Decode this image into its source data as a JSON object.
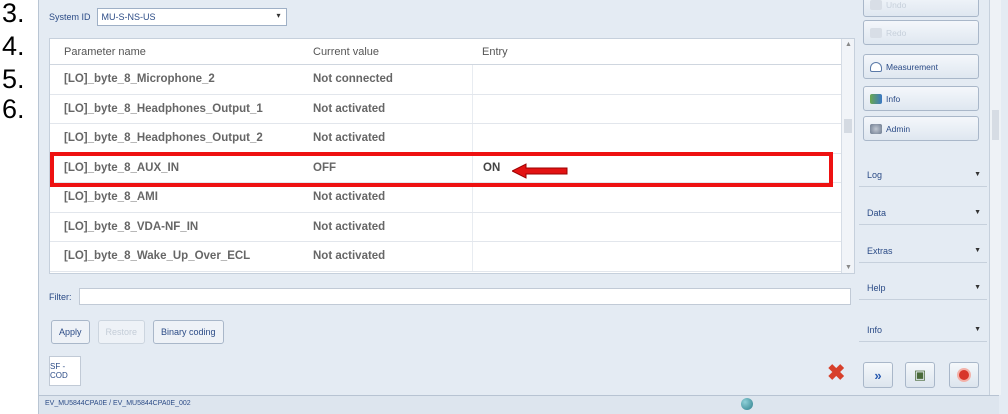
{
  "steps": [
    "3.",
    "4.",
    "5.",
    "6."
  ],
  "system": {
    "label": "System ID",
    "value": "MU-S-NS-US"
  },
  "table": {
    "headers": [
      "Parameter name",
      "Current value",
      "Entry"
    ],
    "rows": [
      {
        "name": "[LO]_byte_8_Microphone_2",
        "value": "Not connected",
        "entry": ""
      },
      {
        "name": "[LO]_byte_8_Headphones_Output_1",
        "value": "Not activated",
        "entry": ""
      },
      {
        "name": "[LO]_byte_8_Headphones_Output_2",
        "value": "Not activated",
        "entry": ""
      },
      {
        "name": "[LO]_byte_8_AUX_IN",
        "value": "OFF",
        "entry": "ON"
      },
      {
        "name": "[LO]_byte_8_AMI",
        "value": "Not activated",
        "entry": ""
      },
      {
        "name": "[LO]_byte_8_VDA-NF_IN",
        "value": "Not activated",
        "entry": ""
      },
      {
        "name": "[LO]_byte_8_Wake_Up_Over_ECL",
        "value": "Not activated",
        "entry": ""
      }
    ]
  },
  "filter": {
    "label": "Filter:",
    "value": ""
  },
  "buttons": {
    "apply": "Apply",
    "restore": "Restore",
    "binary": "Binary coding"
  },
  "sf_cod": "SF - COD",
  "status_text": "EV_MU5844CPA0E / EV_MU5844CPA0E_002",
  "right_panel": {
    "buttons": [
      {
        "label": "Undo",
        "disabled": true
      },
      {
        "label": "Redo",
        "disabled": true
      },
      {
        "label": "Measurement",
        "disabled": false
      },
      {
        "label": "Info",
        "disabled": false
      },
      {
        "label": "Admin",
        "disabled": false
      }
    ],
    "sections": [
      "Log",
      "Data",
      "Extras",
      "Help",
      "Info"
    ]
  },
  "colors": {
    "highlight": "#ee1111",
    "accent_text": "#2b4b86"
  }
}
